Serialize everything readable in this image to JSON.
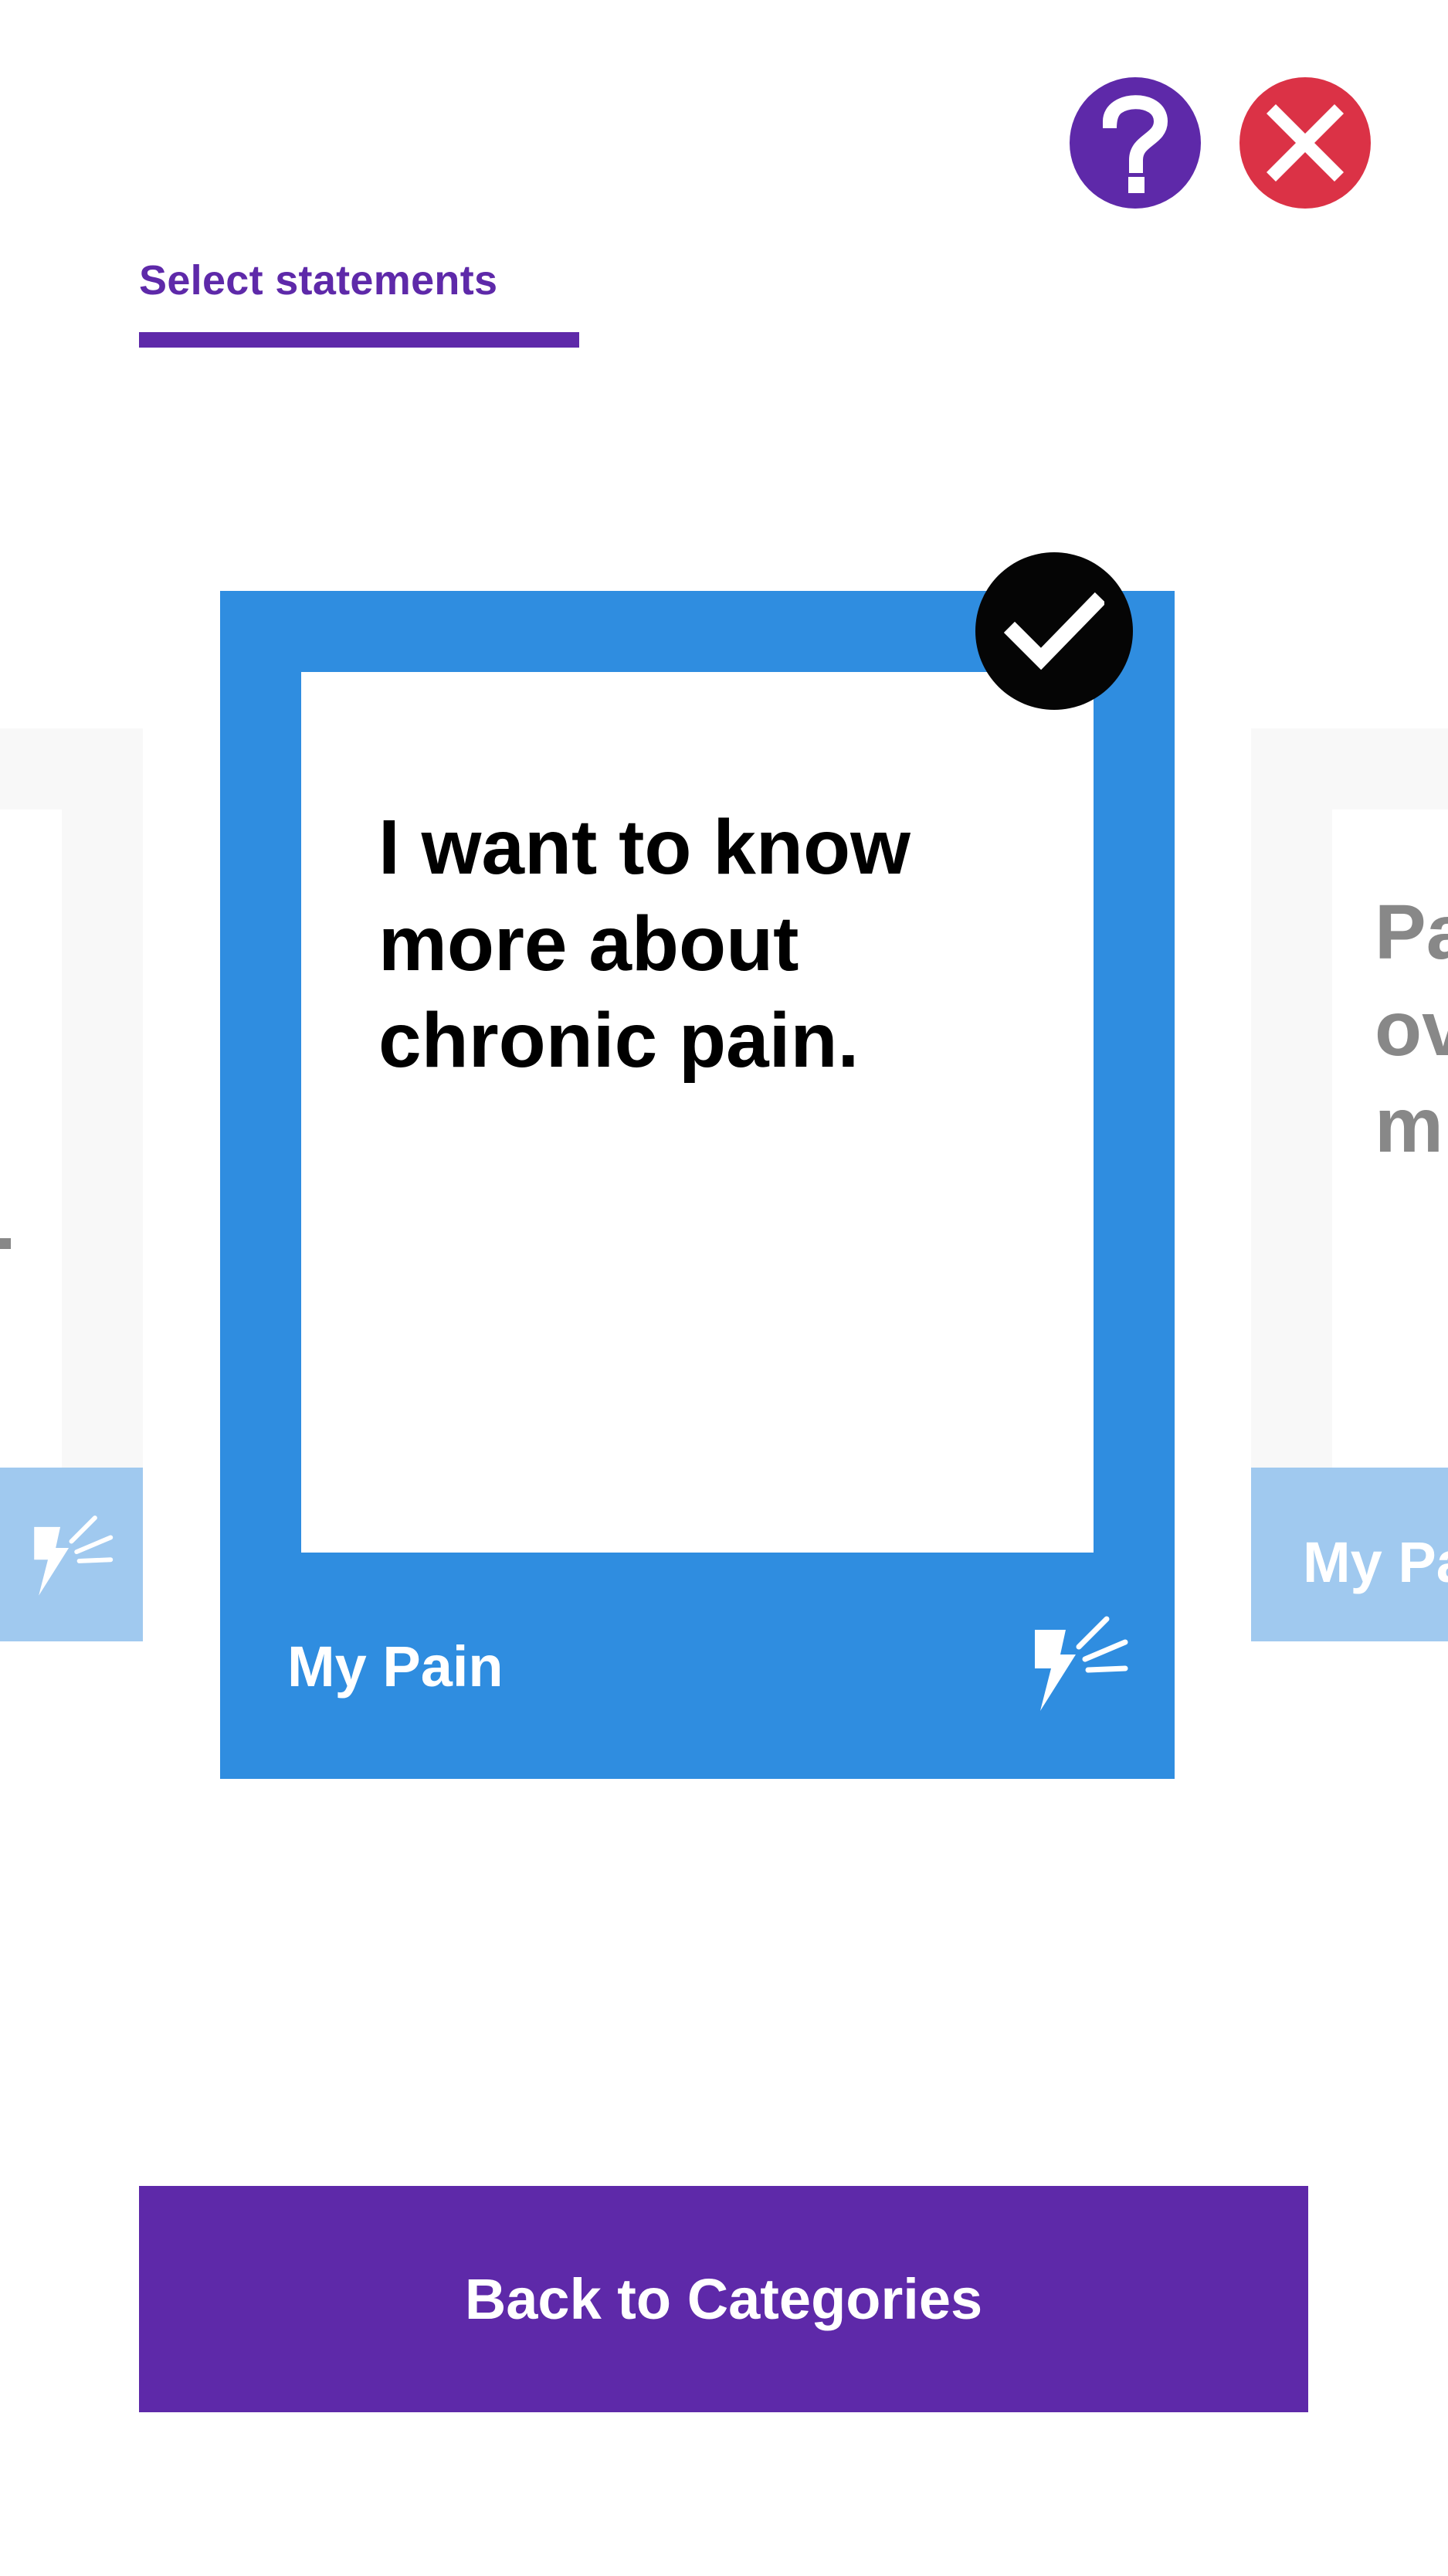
{
  "header": {
    "help_icon": "question-mark-icon",
    "close_icon": "close-x-icon",
    "help_color": "#5e29a9",
    "close_color": "#db3246"
  },
  "tabs": [
    {
      "label": "Select statements",
      "active": true
    }
  ],
  "carousel": {
    "current_card": {
      "statement": "I want to know more about chronic pain.",
      "category": "My Pain",
      "category_icon": "lightning-pain-icon",
      "selected": true,
      "color": "#2f8de0"
    },
    "next_card": {
      "statement_visible_fragment_lines": [
        "Pa",
        "ov",
        "m"
      ],
      "category_visible_fragment": "My Pa"
    }
  },
  "footer": {
    "back_button_label": "Back to Categories",
    "button_color": "#5e29a9"
  }
}
